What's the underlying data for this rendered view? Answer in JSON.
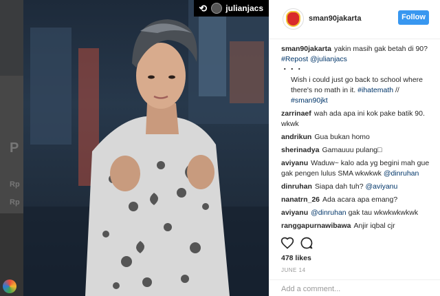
{
  "repost_badge": {
    "icon": "repost-icon",
    "username": "julianjacs"
  },
  "post": {
    "account": "sman90jakarta",
    "follow_label": "Follow",
    "caption": {
      "user": "sman90jakarta",
      "text": "yakin masih gak betah di 90?",
      "repost_tag": "#Repost @julianjacs",
      "dots": "・・・",
      "body": "Wish i could just go back to school where there's no math in it.",
      "body_tag": "#ihatemath",
      "separator": "//",
      "school_tag": "#sman90jkt"
    },
    "comments": [
      {
        "user": "zarrinaef",
        "text": "wah ada apa ini kok pake batik 90. wkwk"
      },
      {
        "user": "andrikun",
        "text": "Gua bukan homo"
      },
      {
        "user": "sherinadya",
        "text": "Gamauuu pulang□"
      },
      {
        "user": "aviyanu",
        "text": "Waduw~ kalo ada yg begini mah gue gak pengen lulus SMA wkwkwk",
        "mention": "@dinruhan"
      },
      {
        "user": "dinruhan",
        "text": "Siapa dah tuh?",
        "mention": "@aviyanu"
      },
      {
        "user": "nanatrn_26",
        "text": "Ada acara apa emang?"
      },
      {
        "user": "aviyanu",
        "mention": "@dinruhan",
        "text": "gak tau wkwkwkwkwk"
      },
      {
        "user": "ranggapurnawibawa",
        "text": "Anjir iqbal cjr"
      }
    ],
    "likes": "478 likes",
    "date": "JUNE 14",
    "add_comment_placeholder": "Add a comment..."
  },
  "backdrop": {
    "mark": "P",
    "price1": "Rp",
    "price2": "Rp"
  },
  "colors": {
    "follow": "#3897f0",
    "hashtag": "#003569",
    "text": "#262626",
    "muted": "#999999"
  }
}
